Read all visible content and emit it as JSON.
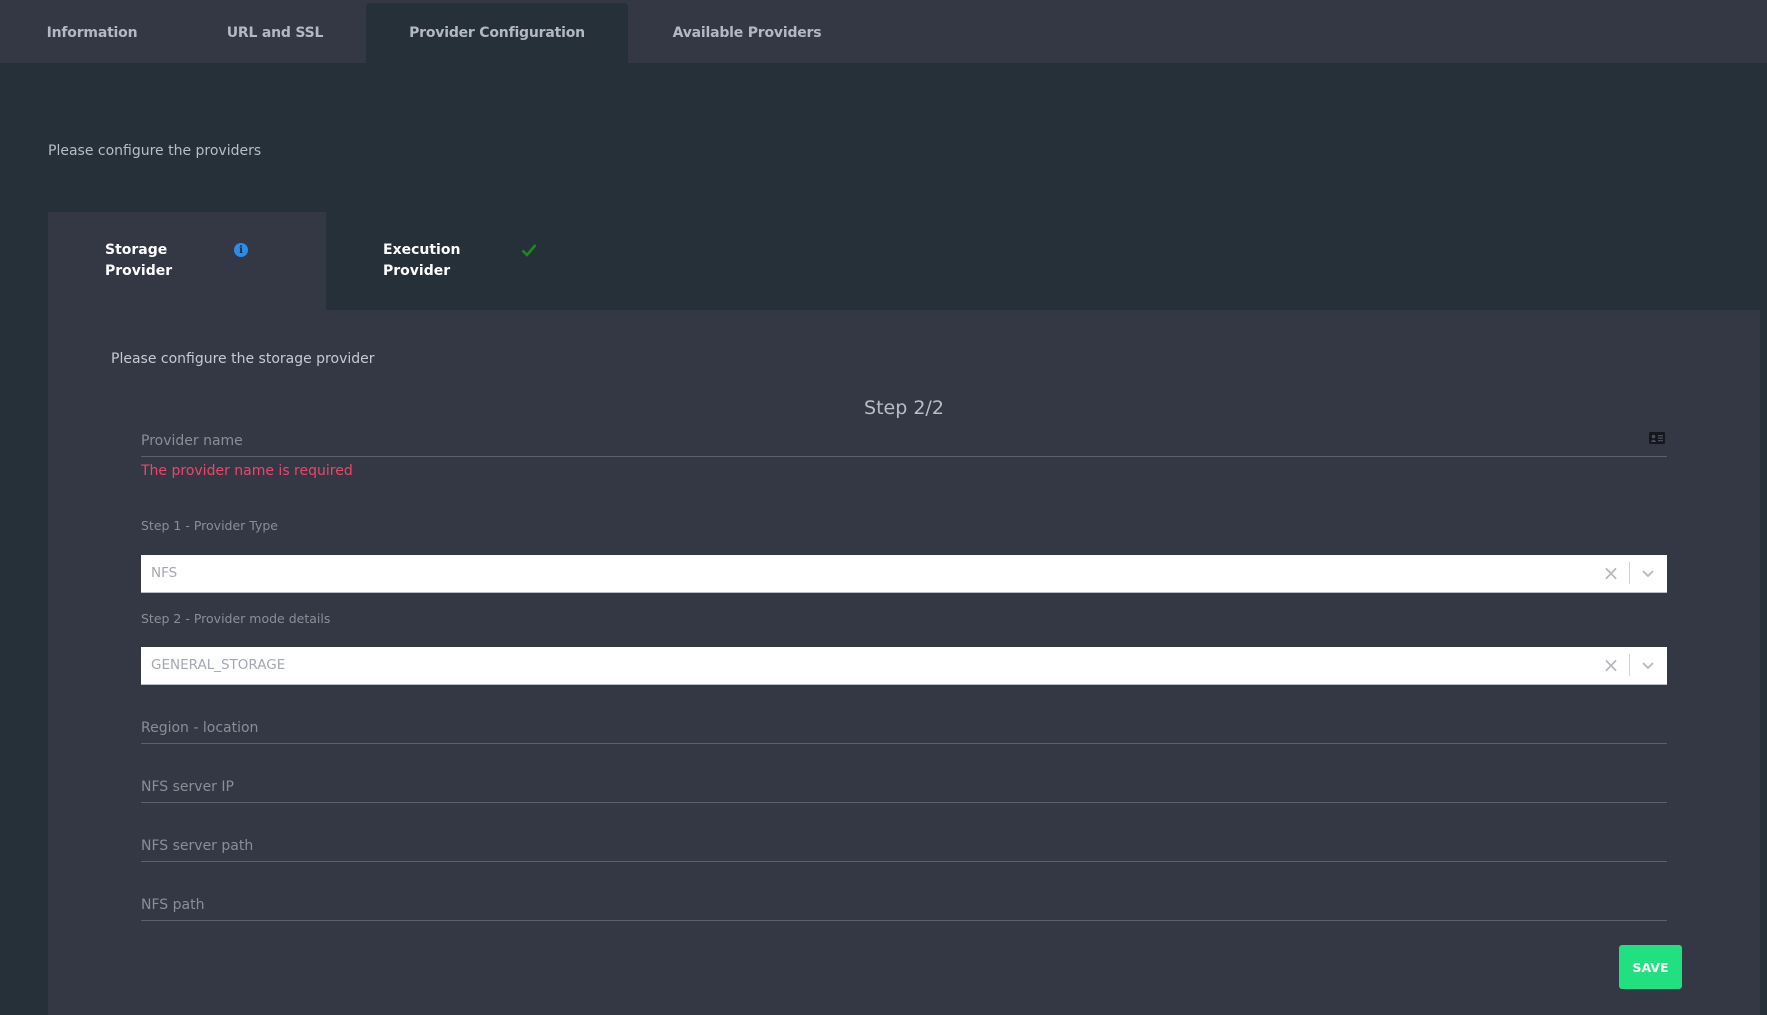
{
  "top_tabs": [
    {
      "label": "Information",
      "active": false
    },
    {
      "label": "URL and SSL",
      "active": false
    },
    {
      "label": "Provider Configuration",
      "active": true
    },
    {
      "label": "Available Providers",
      "active": false
    }
  ],
  "page_intro": "Please configure the providers",
  "provider_tabs": [
    {
      "label": "Storage Provider",
      "status_icon": "info-icon",
      "active": true
    },
    {
      "label": "Execution Provider",
      "status_icon": "check-icon",
      "active": false
    }
  ],
  "colors": {
    "info": "#2d8ceb",
    "check": "#1a8a1a",
    "error": "#f0446a",
    "save": "#20e07f"
  },
  "panel": {
    "intro": "Please configure the storage provider",
    "step_title": "Step 2/2",
    "provider_name": {
      "placeholder": "Provider name",
      "value": "",
      "icon": "address-card-icon"
    },
    "provider_name_error": "The provider name is required",
    "step1": {
      "label": "Step 1 - Provider Type",
      "value": "NFS"
    },
    "step2": {
      "label": "Step 2 - Provider mode details",
      "value": "GENERAL_STORAGE"
    },
    "fields": [
      {
        "placeholder": "Region - location",
        "value": ""
      },
      {
        "placeholder": "NFS server IP",
        "value": ""
      },
      {
        "placeholder": "NFS server path",
        "value": ""
      },
      {
        "placeholder": "NFS path",
        "value": ""
      }
    ],
    "save_label": "SAVE"
  }
}
